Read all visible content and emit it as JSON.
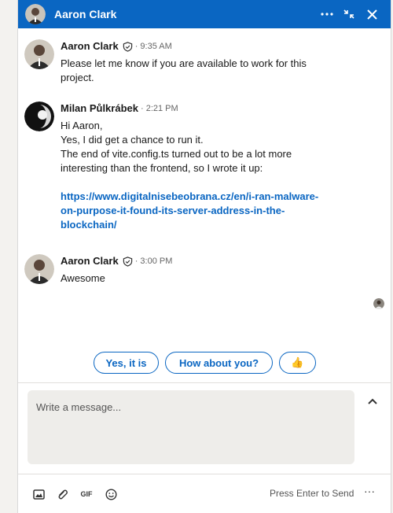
{
  "header": {
    "title": "Aaron Clark"
  },
  "messages": [
    {
      "sender": "Aaron Clark",
      "verified": true,
      "time": "· 9:35 AM",
      "lines": [
        "Please let me know if you are available to work for this",
        "project."
      ]
    },
    {
      "sender": "Milan Půlkrábek",
      "verified": false,
      "time": "· 2:21 PM",
      "lines": [
        "Hi Aaron,",
        "Yes, I did get a chance to run it.",
        "The end of vite.config.ts turned out to be a lot more",
        "interesting than the frontend, so I wrote it up:"
      ],
      "link_lines": [
        "https://www.digitalnisebeobrana.cz/en/i-ran-malware-",
        "on-purpose-it-found-its-server-address-in-the-",
        "blockchain/"
      ]
    },
    {
      "sender": "Aaron Clark",
      "verified": true,
      "time": "· 3:00 PM",
      "lines": [
        "Awesome"
      ]
    }
  ],
  "quick_replies": {
    "r1": "Yes, it is",
    "r2": "How about you?",
    "r3": "👍"
  },
  "composer": {
    "placeholder": "Write a message...",
    "send_hint": "Press Enter to Send"
  },
  "toolbar": {
    "gif_label": "GIF",
    "more_label": "···"
  },
  "colors": {
    "brand": "#0a66c2",
    "header_text": "#ffffff",
    "composer_bg": "#eeedea"
  },
  "icons": {
    "header_more": "ellipsis-icon",
    "minimize": "collapse-icon",
    "close": "close-icon",
    "verified": "verified-shield-icon",
    "image": "image-icon",
    "attach": "paperclip-icon",
    "emoji": "emoji-icon",
    "expand": "chevron-up-icon"
  }
}
